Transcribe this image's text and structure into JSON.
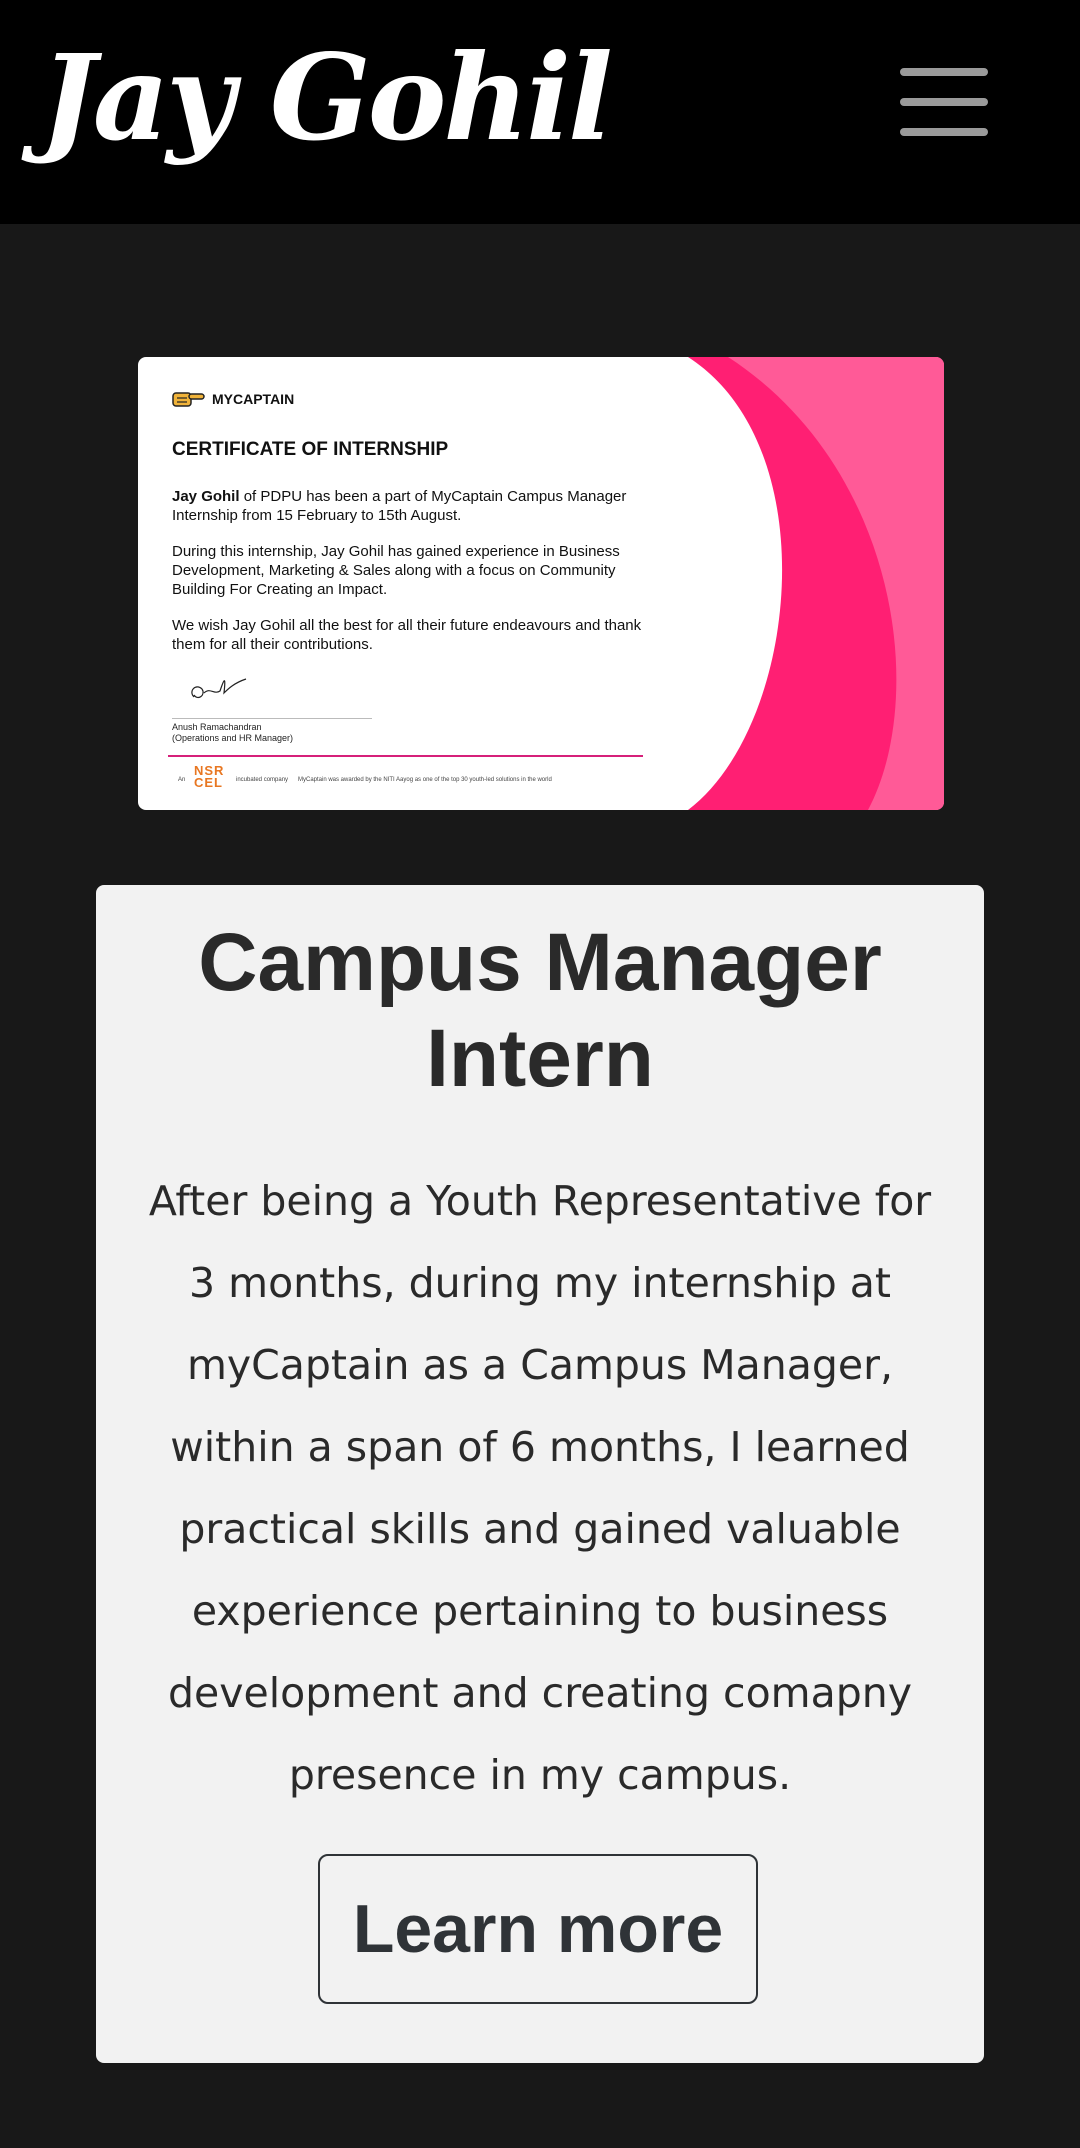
{
  "header": {
    "logo_text": "Jay Gohil",
    "menu_icon": "hamburger-menu-icon"
  },
  "certificate": {
    "brand": "MYCAPTAIN",
    "title": "CERTIFICATE OF INTERNSHIP",
    "recipient_name": "Jay Gohil",
    "paragraph1_rest": " of PDPU has been a part of MyCaptain Campus Manager Internship from 15 February to 15th August.",
    "paragraph2": "During this internship, Jay Gohil has gained experience in Business Development, Marketing & Sales along with a focus on Community Building For Creating an Impact.",
    "paragraph3": "We wish Jay Gohil all the best for all their future endeavours and thank them for all their contributions.",
    "signer_name": "Anush Ramachandran",
    "signer_role": "(Operations and HR Manager)",
    "footer_an": "An",
    "footer_nsr_line1": "NSR",
    "footer_nsr_line2": "CEL",
    "footer_incubated": "incubated company",
    "footer_award": "MyCaptain was awarded by the NITI Aayog as one of the top 30 youth-led solutions in the world",
    "accent_colors": {
      "pink": "#ff1f73",
      "light_pink": "#ff5a97"
    }
  },
  "card": {
    "title": "Campus Manager Intern",
    "description": "After being a Youth Representative for 3 months, during my internship at myCaptain as a Campus Manager, within a span of 6 months, I learned practical skills and gained valuable experience pertaining to business development and creating comapny presence in my campus.",
    "button_label": "Learn more"
  }
}
